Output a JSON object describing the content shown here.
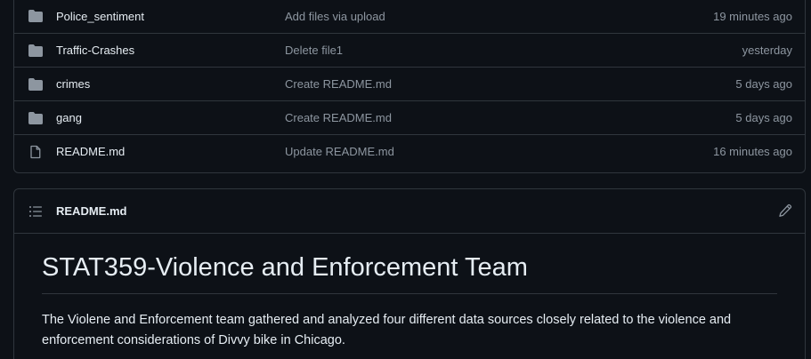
{
  "files": [
    {
      "icon": "folder-icon",
      "name": "Police_sentiment",
      "message": "Add files via upload",
      "time": "19 minutes ago"
    },
    {
      "icon": "folder-icon",
      "name": "Traffic-Crashes",
      "message": "Delete file1",
      "time": "yesterday"
    },
    {
      "icon": "folder-icon",
      "name": "crimes",
      "message": "Create README.md",
      "time": "5 days ago"
    },
    {
      "icon": "folder-icon",
      "name": "gang",
      "message": "Create README.md",
      "time": "5 days ago"
    },
    {
      "icon": "file-icon",
      "name": "README.md",
      "message": "Update README.md",
      "time": "16 minutes ago"
    }
  ],
  "readme": {
    "filename": "README.md",
    "heading": "STAT359-Violence and Enforcement Team",
    "paragraph": "The Violene and Enforcement team gathered and analyzed four different data sources closely related to the violence and enforcement considerations of Divvy bike in Chicago."
  },
  "colors": {
    "background": "#0d1117",
    "border": "#30363d",
    "text": "#e6edf3",
    "muted": "#8d96a0",
    "folder": "#8d96a0"
  }
}
